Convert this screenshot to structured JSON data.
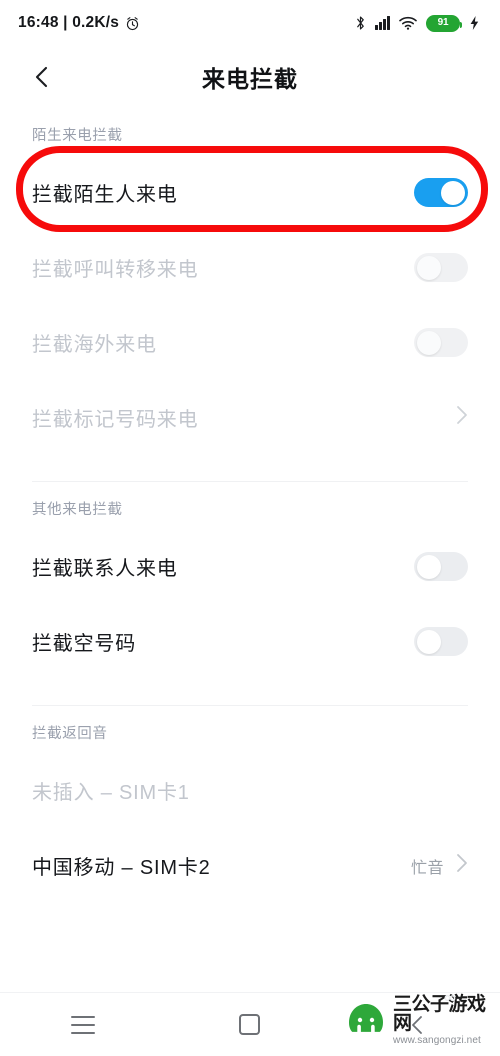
{
  "status_bar": {
    "clock": "16:48 | 0.2K/s",
    "alarm_icon": "alarm-clock-icon",
    "bluetooth_icon": "bluetooth-icon",
    "signal_icon": "cellular-signal-icon",
    "wifi_icon": "wifi-icon",
    "battery_level": "91",
    "battery_color": "#24a533",
    "charging_icon": "lightning-bolt-icon"
  },
  "header": {
    "back_icon": "chevron-left-icon",
    "title": "来电拦截"
  },
  "accent_color": "#199ff0",
  "annotation_color": "#f60b0b",
  "sections": [
    {
      "label": "陌生来电拦截",
      "rows": [
        {
          "label": "拦截陌生人来电",
          "control": "toggle",
          "state": "on",
          "disabled": false,
          "highlighted": true
        },
        {
          "label": "拦截呼叫转移来电",
          "control": "toggle",
          "state": "off",
          "disabled": true,
          "highlighted": false
        },
        {
          "label": "拦截海外来电",
          "control": "toggle",
          "state": "off",
          "disabled": true,
          "highlighted": false
        },
        {
          "label": "拦截标记号码来电",
          "control": "chevron",
          "value": "",
          "disabled": true,
          "highlighted": false
        }
      ]
    },
    {
      "label": "其他来电拦截",
      "rows": [
        {
          "label": "拦截联系人来电",
          "control": "toggle",
          "state": "off",
          "disabled": false,
          "highlighted": false
        },
        {
          "label": "拦截空号码",
          "control": "toggle",
          "state": "off",
          "disabled": false,
          "highlighted": false
        }
      ]
    },
    {
      "label": "拦截返回音",
      "rows": [
        {
          "label": "未插入 – SIM卡1",
          "control": "none",
          "value": "",
          "disabled": true,
          "highlighted": false
        },
        {
          "label": "中国移动 – SIM卡2",
          "control": "chevron",
          "value": "忙音",
          "disabled": false,
          "highlighted": false
        }
      ]
    }
  ],
  "nav_bar": {
    "menu_label": "menu-icon",
    "home_label": "home-square-icon",
    "back_label": "back-chevron-icon"
  },
  "watermark": {
    "title": "三公子游戏网",
    "url": "www.sangongzi.net",
    "logo_icon": "mascot-logo-icon"
  }
}
